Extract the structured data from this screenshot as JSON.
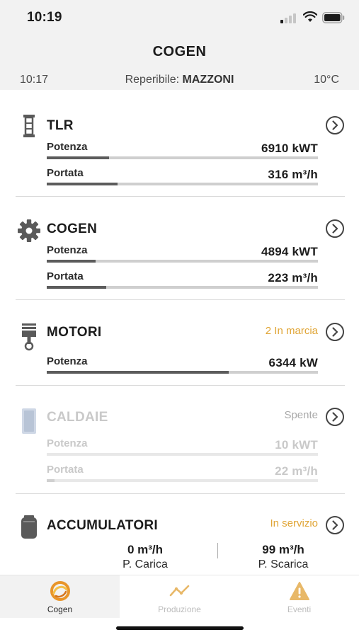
{
  "status_bar": {
    "time": "10:19"
  },
  "header": {
    "title": "COGEN",
    "time": "10:17",
    "reperibile_label": "Reperibile:",
    "reperibile_name": "MAZZONI",
    "temperature": "10°C"
  },
  "sections": {
    "tlr": {
      "title": "TLR",
      "icon": "tlr-icon",
      "metrics": [
        {
          "label": "Potenza",
          "value": "6910 kWT",
          "level": 0.23
        },
        {
          "label": "Portata",
          "value": "316 m³/h",
          "level": 0.26
        }
      ]
    },
    "cogen": {
      "title": "COGEN",
      "icon": "gear-icon",
      "metrics": [
        {
          "label": "Potenza",
          "value": "4894 kWT",
          "level": 0.18
        },
        {
          "label": "Portata",
          "value": "223 m³/h",
          "level": 0.22
        }
      ]
    },
    "motori": {
      "title": "MOTORI",
      "icon": "piston-icon",
      "status": "2 In marcia",
      "metrics": [
        {
          "label": "Potenza",
          "value": "6344 kW",
          "level": 0.67
        }
      ]
    },
    "caldaie": {
      "title": "CALDAIE",
      "icon": "boiler-icon",
      "status": "Spente",
      "metrics": [
        {
          "label": "Potenza",
          "value": "10 kWT",
          "level": 0.0
        },
        {
          "label": "Portata",
          "value": "22 m³/h",
          "level": 0.03
        }
      ]
    },
    "accumulatori": {
      "title": "ACCUMULATORI",
      "icon": "tank-icon",
      "status": "In servizio",
      "carica_value": "0 m³/h",
      "carica_label": "P. Carica",
      "scarica_value": "99 m³/h",
      "scarica_label": "P. Scarica"
    }
  },
  "tabs": [
    {
      "label": "Cogen",
      "icon": "cogen-logo-icon",
      "active": true
    },
    {
      "label": "Produzione",
      "icon": "chart-line-icon",
      "active": false
    },
    {
      "label": "Eventi",
      "icon": "warning-icon",
      "active": false
    }
  ],
  "colors": {
    "accent": "#e0a536",
    "bar_fill": "#5c5c5c",
    "bar_track": "#cfcfcf",
    "disabled": "#c9c9c9"
  }
}
